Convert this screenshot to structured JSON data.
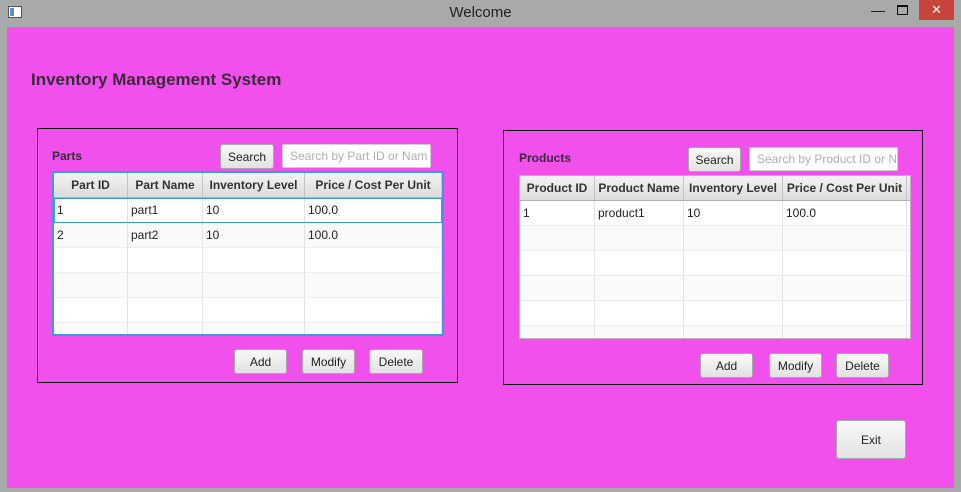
{
  "window": {
    "title": "Welcome"
  },
  "app": {
    "title": "Inventory Management System"
  },
  "parts": {
    "title": "Parts",
    "search_label": "Search",
    "search_placeholder": "Search by Part ID or Nam",
    "columns": [
      "Part ID",
      "Part Name",
      "Inventory Level",
      "Price / Cost Per Unit"
    ],
    "rows": [
      [
        "1",
        "part1",
        "10",
        "100.0"
      ],
      [
        "2",
        "part2",
        "10",
        "100.0"
      ]
    ],
    "add_label": "Add",
    "modify_label": "Modify",
    "delete_label": "Delete"
  },
  "products": {
    "title": "Products",
    "search_label": "Search",
    "search_placeholder": "Search by Product ID or N",
    "columns": [
      "Product ID",
      "Product Name",
      "Inventory Level",
      "Price / Cost Per Unit"
    ],
    "rows": [
      [
        "1",
        "product1",
        "10",
        "100.0"
      ]
    ],
    "add_label": "Add",
    "modify_label": "Modify",
    "delete_label": "Delete"
  },
  "exit_label": "Exit",
  "colors": {
    "background": "#f250ed",
    "focus": "#3d9ad6",
    "close": "#c7443a"
  },
  "icons": [
    "app-icon",
    "minimize-icon",
    "maximize-icon",
    "close-icon"
  ]
}
